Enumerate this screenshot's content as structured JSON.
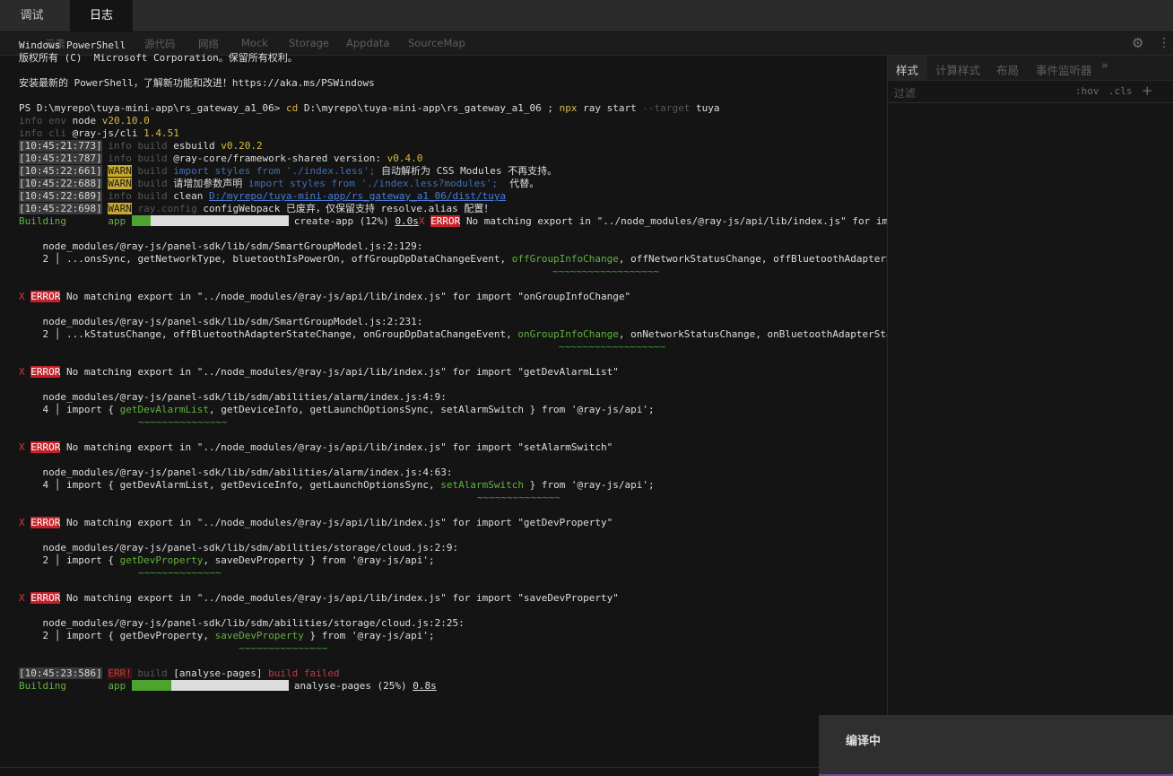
{
  "top_tabs": [
    {
      "label": "调试",
      "active": false
    },
    {
      "label": "日志",
      "active": true
    }
  ],
  "devtools_tabs": [
    "元素",
    "源代码",
    "网络",
    "Mock",
    "Storage",
    "Appdata",
    "SourceMap"
  ],
  "sidebar": {
    "tabs": [
      "样式",
      "计算样式",
      "布局",
      "事件监听器"
    ],
    "filter_placeholder": "过滤",
    "hov": ":hov",
    "cls": ".cls",
    "add": "+"
  },
  "icons": {
    "settings": "gear-icon",
    "more": "vertical-dots-icon",
    "chevron": "double-chevron-right-icon"
  },
  "colors": {
    "background": "#141414",
    "warn": "#c9a92d",
    "error": "#c4222b",
    "success": "#4ca32e"
  },
  "terminal": {
    "header1": "Windows PowerShell",
    "header2": "版权所有 (C)  Microsoft Corporation。保留所有权利。",
    "header3": "安装最新的 PowerShell，了解新功能和改进！https://aka.ms/PSWindows",
    "prompt": "PS D:\\myrepo\\tuya-mini-app\\rs_gateway_a1_06> ",
    "cmd_cd": "cd",
    "cmd_path": " D:\\myrepo\\tuya-mini-app\\rs_gateway_a1_06 ; ",
    "cmd_npx": "npx",
    "cmd_rest": " ray start ",
    "cmd_flag": "--target",
    "cmd_target": " tuya",
    "env": {
      "level": "info",
      "tag": " env ",
      "name": "node ",
      "version": "v20.10.0"
    },
    "cli": {
      "level": "info",
      "tag": " cli ",
      "name": "@ray-js/cli ",
      "version": "1.4.51"
    },
    "logs": {
      "l1": {
        "ts": "[10:45:21:773]",
        "level": " info ",
        "tag": "build ",
        "text": "esbuild ",
        "ver": "v0.20.2"
      },
      "l2": {
        "ts": "[10:45:21:787]",
        "level": " info ",
        "tag": "build ",
        "text": "@ray-core/framework-shared version: ",
        "ver": "v0.4.0"
      },
      "l3": {
        "ts": "[10:45:22:661]",
        "warn": "WARN",
        "tag": " build ",
        "code": "import styles from './index.less';",
        "text": " 自动解析为 CSS Modules 不再支持。"
      },
      "l4": {
        "ts": "[10:45:22:688]",
        "warn": "WARN",
        "tag": " build ",
        "text1": "请增加参数声明 ",
        "code": "import styles from './index.less?modules';",
        "text2": "  代替。"
      },
      "l5": {
        "ts": "[10:45:22:689]",
        "level": " info ",
        "tag": "build ",
        "text": "clean ",
        "path": "D:/myrepo/tuya-mini-app/rs_gateway_a1_06/dist/tuya"
      },
      "l6": {
        "ts": "[10:45:22:698]",
        "warn": "WARN",
        "tag": " ray.config ",
        "text": "configWebpack 已废弃，仅保留支持 resolve.alias 配置！"
      }
    },
    "building1": {
      "label": "Building",
      "tag": "app",
      "progress": 0.12,
      "text": "create-app (12%) ",
      "time": "0.0s"
    },
    "errors": [
      {
        "badge": "ERROR",
        "msg": "No matching export in \"../node_modules/@ray-js/api/lib/index.js\" for import \"offGroupInfoChange\"",
        "file": "node_modules/@ray-js/panel-sdk/lib/sdm/SmartGroupModel.js:2:129:",
        "lineno": "2",
        "pre": "...onsSync, getNetworkType, bluetoothIsPowerOn, offGroupDpDataChangeEvent, ",
        "hl": "offGroupInfoChange",
        "post": ", offNetworkStatusChange, offBluetoothAdapterStateChange, onGroupDpDataC...",
        "squig": "~~~~~~~~~~~~~~~~~~"
      },
      {
        "badge": "ERROR",
        "msg": "No matching export in \"../node_modules/@ray-js/api/lib/index.js\" for import \"onGroupInfoChange\"",
        "file": "node_modules/@ray-js/panel-sdk/lib/sdm/SmartGroupModel.js:2:231:",
        "lineno": "2",
        "pre": "...kStatusChange, offBluetoothAdapterStateChange, onGroupDpDataChangeEvent, ",
        "hl": "onGroupInfoChange",
        "post": ", onNetworkStatusChange, onBluetoothAdapterStateChange } from '@ray-js/a...",
        "squig": "~~~~~~~~~~~~~~~~~~"
      },
      {
        "badge": "ERROR",
        "msg": "No matching export in \"../node_modules/@ray-js/api/lib/index.js\" for import \"getDevAlarmList\"",
        "file": "node_modules/@ray-js/panel-sdk/lib/sdm/abilities/alarm/index.js:4:9:",
        "lineno": "4",
        "pre": "import { ",
        "hl": "getDevAlarmList",
        "post": ", getDeviceInfo, getLaunchOptionsSync, setAlarmSwitch } from '@ray-js/api';",
        "squig": "~~~~~~~~~~~~~~~"
      },
      {
        "badge": "ERROR",
        "msg": "No matching export in \"../node_modules/@ray-js/api/lib/index.js\" for import \"setAlarmSwitch\"",
        "file": "node_modules/@ray-js/panel-sdk/lib/sdm/abilities/alarm/index.js:4:63:",
        "lineno": "4",
        "pre": "import { getDevAlarmList, getDeviceInfo, getLaunchOptionsSync, ",
        "hl": "setAlarmSwitch",
        "post": " } from '@ray-js/api';",
        "squig": "~~~~~~~~~~~~~~"
      },
      {
        "badge": "ERROR",
        "msg": "No matching export in \"../node_modules/@ray-js/api/lib/index.js\" for import \"getDevProperty\"",
        "file": "node_modules/@ray-js/panel-sdk/lib/sdm/abilities/storage/cloud.js:2:9:",
        "lineno": "2",
        "pre": "import { ",
        "hl": "getDevProperty",
        "post": ", saveDevProperty } from '@ray-js/api';",
        "squig": "~~~~~~~~~~~~~~"
      },
      {
        "badge": "ERROR",
        "msg": "No matching export in \"../node_modules/@ray-js/api/lib/index.js\" for import \"saveDevProperty\"",
        "file": "node_modules/@ray-js/panel-sdk/lib/sdm/abilities/storage/cloud.js:2:25:",
        "lineno": "2",
        "pre": "import { getDevProperty, ",
        "hl": "saveDevProperty",
        "post": " } from '@ray-js/api';",
        "squig": "~~~~~~~~~~~~~~~"
      }
    ],
    "failed": {
      "ts": "[10:45:23:586]",
      "badge": "ERR!",
      "tag": " build ",
      "text": "[analyse-pages] ",
      "status": "build failed"
    },
    "building2": {
      "label": "Building",
      "tag": "app",
      "progress": 0.25,
      "text": "analyse-pages (25%) ",
      "time": "0.8s"
    }
  },
  "toast": {
    "text": "编译中"
  }
}
